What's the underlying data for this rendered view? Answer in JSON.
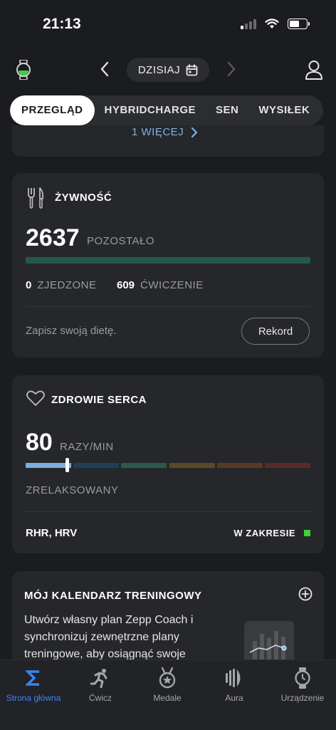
{
  "status": {
    "time": "21:13"
  },
  "header": {
    "date_label": "DZISIAJ"
  },
  "tabs": [
    {
      "label": "PRZEGLĄD",
      "active": true
    },
    {
      "label": "HYBRIDCHARGE",
      "active": false
    },
    {
      "label": "SEN",
      "active": false
    },
    {
      "label": "WYSIŁEK",
      "active": false
    }
  ],
  "more_link": {
    "label": "1 WIĘCEJ"
  },
  "food": {
    "title": "ŻYWNOŚĆ",
    "remaining_value": "2637",
    "remaining_label": "POZOSTAŁO",
    "eaten_value": "0",
    "eaten_label": "ZJEDZONE",
    "exercise_value": "609",
    "exercise_label": "ĆWICZENIE",
    "prompt": "Zapisz swoją dietę.",
    "record_button": "Rekord"
  },
  "heart": {
    "title": "ZDROWIE SERCA",
    "value": "80",
    "unit": "RAZY/MIN",
    "zone_label": "ZRELAKSOWANY",
    "metrics_label": "RHR, HRV",
    "range_status": "W ZAKRESIE",
    "range_color": "#3ecf3e",
    "zone_colors": [
      "#7eaede",
      "#1f3f5a",
      "#2a5a4a",
      "#5a4a2a",
      "#5a3a25",
      "#5a2a2a"
    ],
    "level_fraction": 0.14
  },
  "calendar": {
    "title": "MÓJ KALENDARZ TRENINGOWY",
    "description": "Utwórz własny plan Zepp Coach i synchronizuj zewnętrzne plany treningowe, aby osiągnąć swoje"
  },
  "bottom_nav": [
    {
      "label": "Strona główna",
      "icon": "sigma-icon",
      "active": true
    },
    {
      "label": "Ćwicz",
      "icon": "running-icon",
      "active": false
    },
    {
      "label": "Medale",
      "icon": "medal-icon",
      "active": false
    },
    {
      "label": "Aura",
      "icon": "aura-icon",
      "active": false
    },
    {
      "label": "Urządzenie",
      "icon": "watch-icon",
      "active": false
    }
  ],
  "colors": {
    "accent": "#3b82f6",
    "background": "#1b1c1f",
    "card": "#26272a"
  }
}
